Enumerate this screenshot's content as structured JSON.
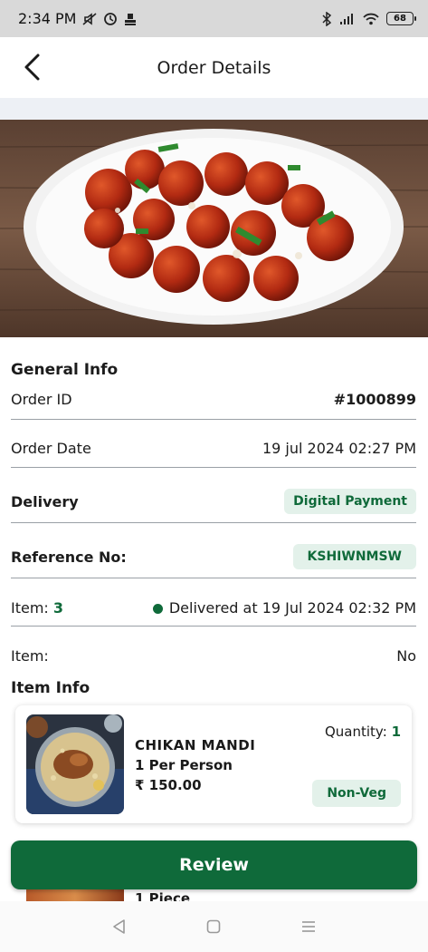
{
  "status_bar": {
    "time": "2:34 PM",
    "battery": "68"
  },
  "header": {
    "title": "Order Details"
  },
  "general_info": {
    "heading": "General Info",
    "order_id_label": "Order ID",
    "order_id_value": "#1000899",
    "order_date_label": "Order Date",
    "order_date_value": "19 jul 2024 02:27 PM",
    "delivery_label": "Delivery",
    "delivery_value": "Digital Payment",
    "reference_label": "Reference No:",
    "reference_value": "KSHIWNMSW",
    "item_label": "Item:",
    "item_count": "3",
    "delivered_status": "Delivered at 19 Jul 2024 02:32 PM",
    "item2_label": "Item:",
    "item2_value": "No"
  },
  "item_info": {
    "heading": "Item Info",
    "item": {
      "name": "CHIKAN MANDI",
      "portion": "1 Per Person",
      "price": "₹ 150.00",
      "quantity_label": "Quantity:",
      "quantity_value": "1",
      "tag": "Non-Veg"
    },
    "next_item_partial": "1 Piece"
  },
  "review_button": {
    "label": "Review"
  },
  "colors": {
    "accent": "#0f6a3a",
    "pill_bg": "#e3f1ea",
    "status_bar": "#d9d9d9"
  }
}
